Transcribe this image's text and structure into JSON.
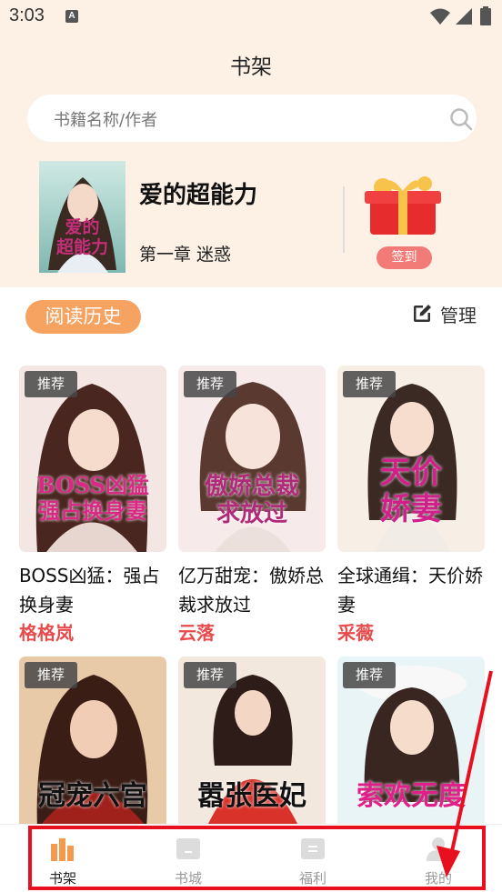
{
  "status_bar": {
    "time": "3:03",
    "notification_icon": "A"
  },
  "header": {
    "title": "书架"
  },
  "search": {
    "placeholder": "书籍名称/作者"
  },
  "current_reading": {
    "title": "爱的超能力",
    "chapter": "第一章 迷惑",
    "cover_text": "爱的\n超能力",
    "signin_label": "签到"
  },
  "history": {
    "tab_label": "阅读历史",
    "manage_label": "管理"
  },
  "books": [
    {
      "badge": "推荐",
      "cover_text": "BOSS凶猛\n强占换身妻",
      "title": "BOSS凶猛：强占换身妻",
      "author": "格格岚"
    },
    {
      "badge": "推荐",
      "cover_text": "傲娇总裁\n求放过",
      "title": "亿万甜宠：傲娇总裁求放过",
      "author": "云落"
    },
    {
      "badge": "推荐",
      "cover_text": "天价\n娇妻",
      "title": "全球通缉：天价娇妻",
      "author": "采薇"
    },
    {
      "badge": "推荐",
      "cover_text": "冠宠六宫",
      "title": "",
      "author": ""
    },
    {
      "badge": "推荐",
      "cover_text": "嚣张医妃",
      "title": "",
      "author": ""
    },
    {
      "badge": "推荐",
      "cover_text": "索欢无度",
      "title": "",
      "author": ""
    }
  ],
  "bottom_nav": [
    {
      "label": "书架",
      "active": true
    },
    {
      "label": "书城",
      "active": false
    },
    {
      "label": "福利",
      "active": false
    },
    {
      "label": "我的",
      "active": false
    }
  ],
  "colors": {
    "accent_orange": "#f6a261",
    "author_red": "#e84b4b",
    "highlight_red": "#e8101f",
    "top_bg": "#fdf1e6"
  }
}
